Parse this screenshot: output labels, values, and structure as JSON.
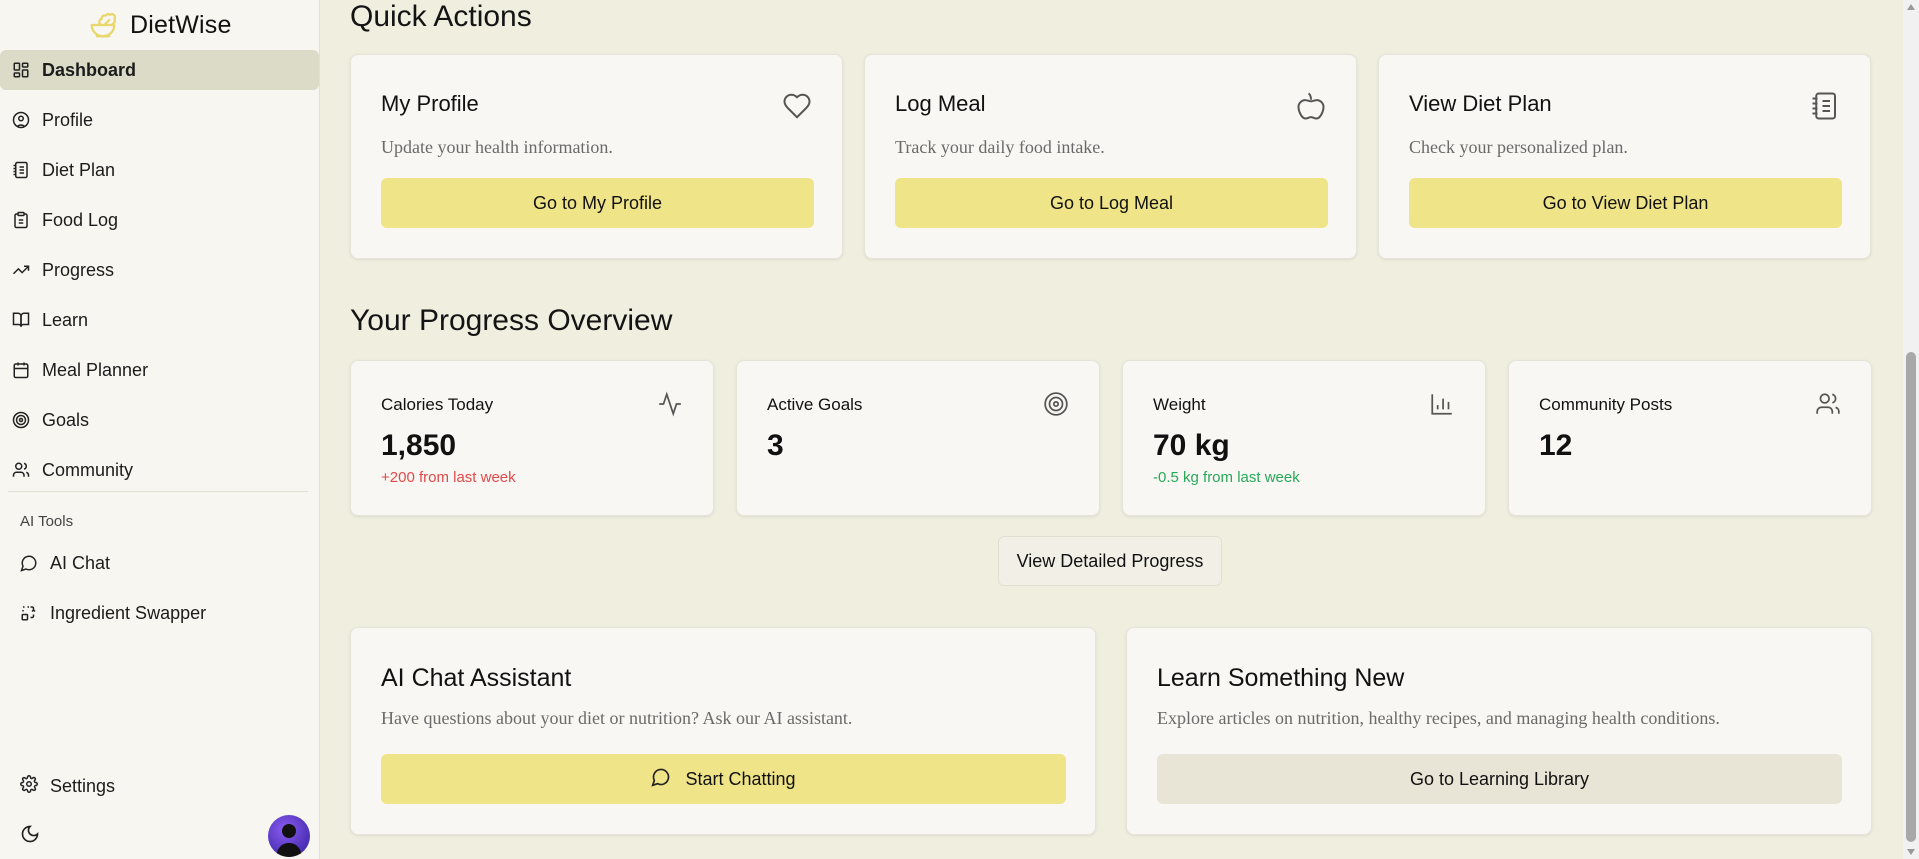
{
  "brand": {
    "name": "DietWise",
    "icon": "salad-bowl-icon",
    "accent": "#f0e488"
  },
  "sidebar": {
    "items": [
      {
        "label": "Dashboard",
        "icon": "dashboard-grid-icon",
        "active": true
      },
      {
        "label": "Profile",
        "icon": "user-circle-icon"
      },
      {
        "label": "Diet Plan",
        "icon": "notebook-icon"
      },
      {
        "label": "Food Log",
        "icon": "clipboard-icon"
      },
      {
        "label": "Progress",
        "icon": "trending-up-icon"
      },
      {
        "label": "Learn",
        "icon": "book-open-icon"
      },
      {
        "label": "Meal Planner",
        "icon": "calendar-icon"
      },
      {
        "label": "Goals",
        "icon": "target-icon"
      },
      {
        "label": "Community",
        "icon": "users-icon"
      }
    ],
    "section_label": "AI Tools",
    "ai_items": [
      {
        "label": "AI Chat",
        "icon": "message-circle-icon"
      },
      {
        "label": "Ingredient Swapper",
        "icon": "swap-icon"
      }
    ],
    "settings_label": "Settings"
  },
  "quick_actions": {
    "heading": "Quick Actions",
    "cards": [
      {
        "title": "My Profile",
        "desc": "Update your health information.",
        "button": "Go to My Profile",
        "icon": "heart-icon"
      },
      {
        "title": "Log Meal",
        "desc": "Track your daily food intake.",
        "button": "Go to Log Meal",
        "icon": "apple-icon"
      },
      {
        "title": "View Diet Plan",
        "desc": "Check your personalized plan.",
        "button": "Go to View Diet Plan",
        "icon": "notebook-icon"
      }
    ]
  },
  "progress": {
    "heading": "Your Progress Overview",
    "stats": [
      {
        "label": "Calories Today",
        "value": "1,850",
        "change": "+200 from last week",
        "tone": "red",
        "icon": "activity-icon"
      },
      {
        "label": "Active Goals",
        "value": "3",
        "change": "",
        "icon": "target-icon"
      },
      {
        "label": "Weight",
        "value": "70 kg",
        "change": "-0.5 kg from last week",
        "tone": "green",
        "icon": "bar-chart-icon"
      },
      {
        "label": "Community Posts",
        "value": "12",
        "change": "",
        "icon": "users-icon"
      }
    ],
    "detail_button": "View Detailed Progress"
  },
  "bottom": {
    "chat": {
      "title": "AI Chat Assistant",
      "desc": "Have questions about your diet or nutrition? Ask our AI assistant.",
      "button": "Start Chatting",
      "icon": "message-circle-icon"
    },
    "learn": {
      "title": "Learn Something New",
      "desc": "Explore articles on nutrition, healthy recipes, and managing health conditions.",
      "button": "Go to Learning Library"
    }
  }
}
